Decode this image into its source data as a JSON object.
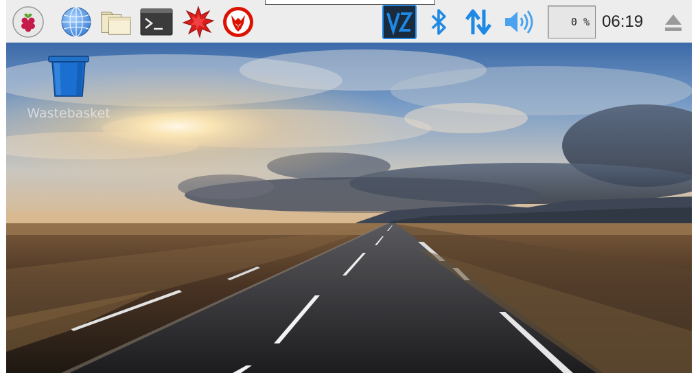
{
  "taskbar": {
    "menu_icon": "raspberry-pi-icon",
    "launchers": [
      "web-browser-icon",
      "file-manager-icon",
      "terminal-icon",
      "mathematica-icon",
      "wolfram-icon"
    ],
    "tray": {
      "vnc_label": "V2",
      "cpu_usage": "0 %",
      "clock": "06:19"
    }
  },
  "desktop": {
    "icons": [
      {
        "label": "Wastebasket",
        "icon": "trash-icon"
      }
    ]
  },
  "colors": {
    "taskbar_bg": "#ededed",
    "tray_accent": "#1e88e5",
    "vnc_bg": "#1a2b3d",
    "trash_blue": "#1565c0"
  }
}
